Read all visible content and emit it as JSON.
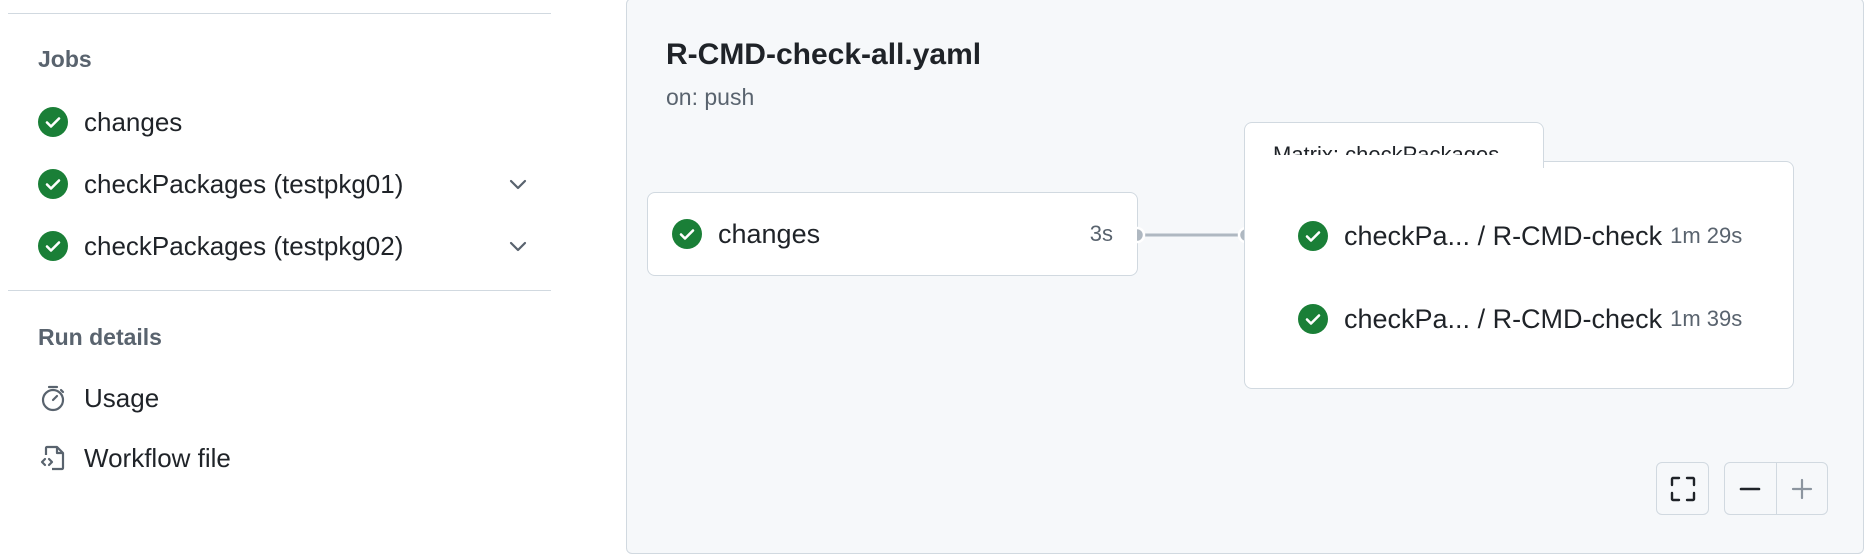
{
  "sidebar": {
    "jobs_title": "Jobs",
    "jobs": [
      {
        "label": "changes",
        "status": "success",
        "expandable": false
      },
      {
        "label": "checkPackages (testpkg01)",
        "status": "success",
        "expandable": true
      },
      {
        "label": "checkPackages (testpkg02)",
        "status": "success",
        "expandable": true
      }
    ],
    "run_details_title": "Run details",
    "run_details": [
      {
        "label": "Usage",
        "icon": "stopwatch-icon"
      },
      {
        "label": "Workflow file",
        "icon": "file-code-icon"
      }
    ]
  },
  "graph": {
    "title": "R-CMD-check-all.yaml",
    "trigger": "on: push",
    "changes_node": {
      "label": "changes",
      "duration": "3s"
    },
    "matrix": {
      "label": "Matrix: checkPackages",
      "items": [
        {
          "name": "checkPa...  / R-CMD-check",
          "duration": "1m 29s"
        },
        {
          "name": "checkPa...  / R-CMD-check",
          "duration": "1m 39s"
        }
      ]
    }
  },
  "colors": {
    "success": "#1a7f37",
    "muted": "#59636e",
    "border": "#d1d9e0",
    "canvas_bg": "#f6f8fa"
  }
}
